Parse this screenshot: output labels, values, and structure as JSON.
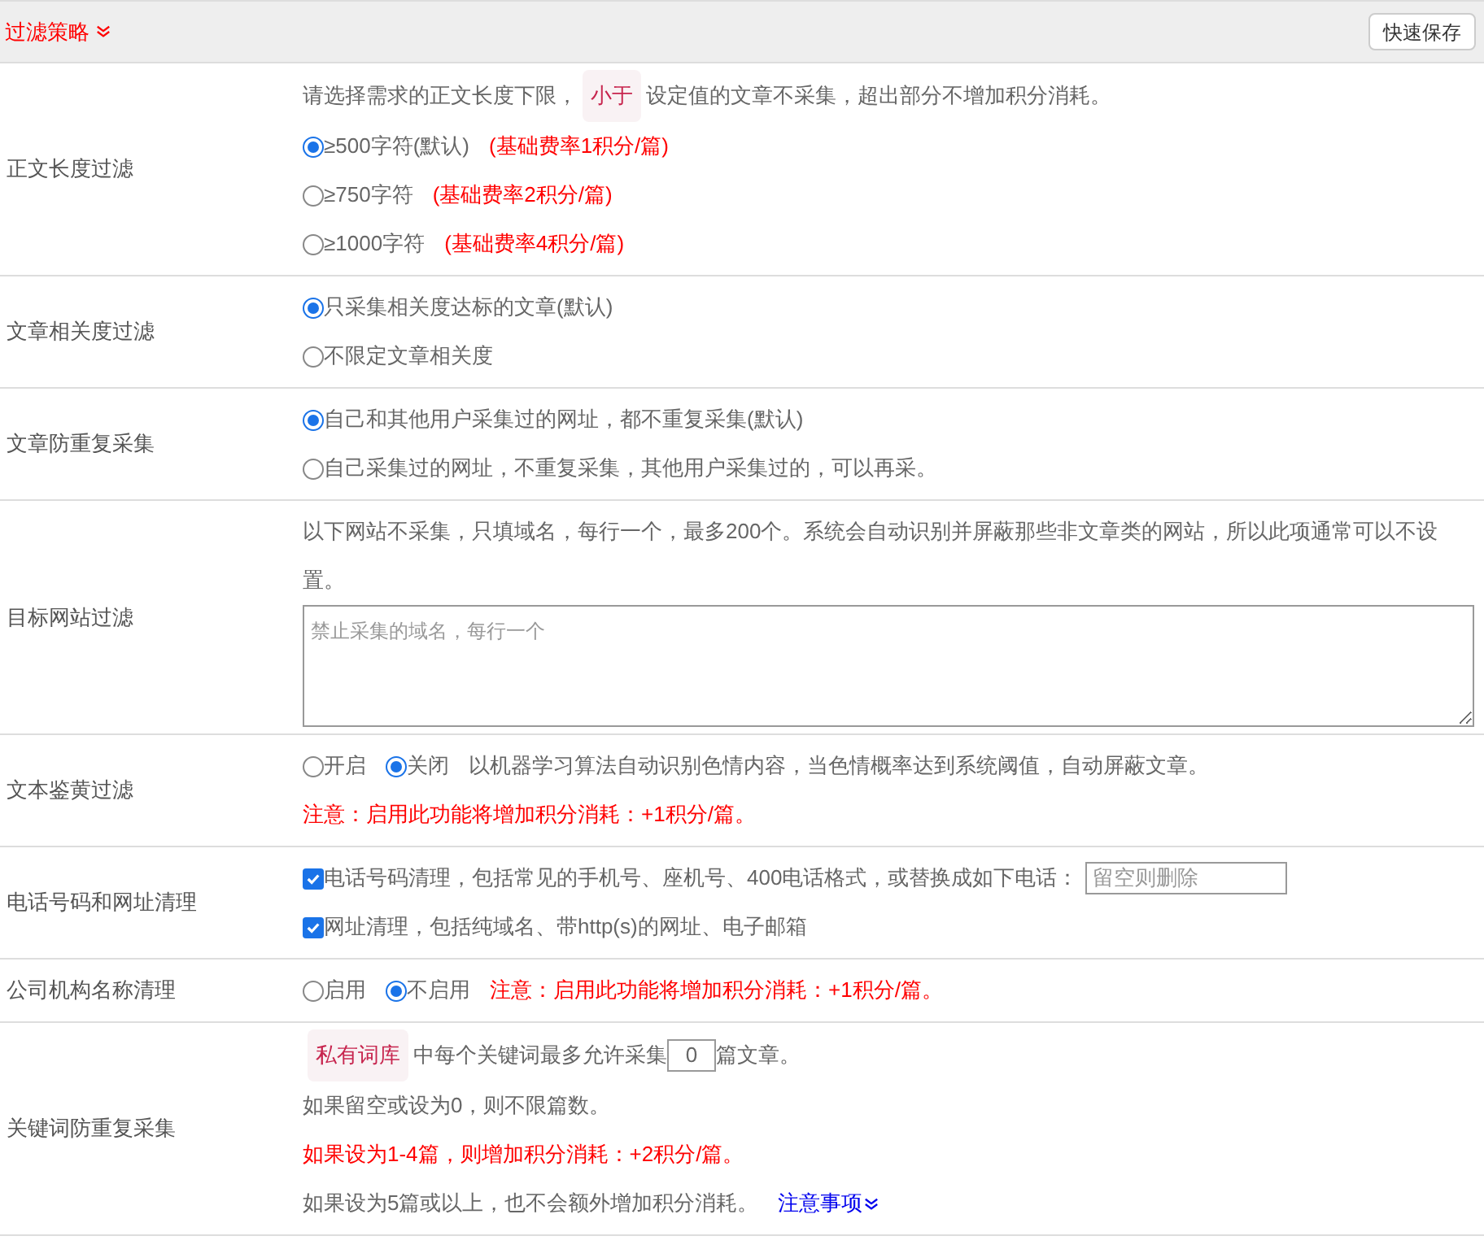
{
  "header": {
    "title": "过滤策略",
    "save_button": "快速保存"
  },
  "sections": [
    {
      "label": "正文长度过滤",
      "lines": [
        [
          {
            "kind": "text",
            "text": "请选择需求的正文长度下限，"
          },
          {
            "kind": "tag",
            "text": "小于"
          },
          {
            "kind": "text",
            "text": "设定值的文章不采集，超出部分不增加积分消耗。"
          }
        ],
        [
          {
            "kind": "radio",
            "label": "≥500字符(默认)",
            "selected": true
          },
          {
            "kind": "note",
            "text": "(基础费率1积分/篇)"
          }
        ],
        [
          {
            "kind": "radio",
            "label": "≥750字符",
            "selected": false
          },
          {
            "kind": "note",
            "text": "(基础费率2积分/篇)"
          }
        ],
        [
          {
            "kind": "radio",
            "label": "≥1000字符",
            "selected": false
          },
          {
            "kind": "note",
            "text": "(基础费率4积分/篇)"
          }
        ]
      ]
    },
    {
      "label": "文章相关度过滤",
      "lines": [
        [
          {
            "kind": "radio",
            "label": "只采集相关度达标的文章(默认)",
            "selected": true
          }
        ],
        [
          {
            "kind": "radio",
            "label": "不限定文章相关度",
            "selected": false
          }
        ]
      ]
    },
    {
      "label": "文章防重复采集",
      "lines": [
        [
          {
            "kind": "radio",
            "label": "自己和其他用户采集过的网址，都不重复采集(默认)",
            "selected": true
          }
        ],
        [
          {
            "kind": "radio",
            "label": "自己采集过的网址，不重复采集，其他用户采集过的，可以再采。",
            "selected": false
          }
        ]
      ]
    },
    {
      "label": "目标网站过滤",
      "lines": [
        [
          {
            "kind": "text",
            "text": "以下网站不采集，只填域名，每行一个，最多200个。系统会自动识别并屏蔽那些非文章类的网站，所以此项通常可以不设置。"
          }
        ],
        [
          {
            "kind": "textarea",
            "placeholder": "禁止采集的域名，每行一个"
          }
        ]
      ]
    },
    {
      "label": "文本鉴黄过滤",
      "lines": [
        [
          {
            "kind": "radio",
            "label": "开启",
            "selected": false
          },
          {
            "kind": "radio",
            "label": "关闭",
            "selected": true
          },
          {
            "kind": "text",
            "text": "以机器学习算法自动识别色情内容，当色情概率达到系统阈值，自动屏蔽文章。"
          }
        ],
        [
          {
            "kind": "note",
            "text": "注意：启用此功能将增加积分消耗：+1积分/篇。"
          }
        ]
      ]
    },
    {
      "label": "电话号码和网址清理",
      "lines": [
        [
          {
            "kind": "checkbox",
            "label": "电话号码清理，包括常见的手机号、座机号、400电话格式，或替换成如下电话：",
            "checked": true
          },
          {
            "kind": "input",
            "placeholder": "留空则删除"
          }
        ],
        [
          {
            "kind": "checkbox",
            "label": "网址清理，包括纯域名、带http(s)的网址、电子邮箱",
            "checked": true
          }
        ]
      ]
    },
    {
      "label": "公司机构名称清理",
      "lines": [
        [
          {
            "kind": "radio",
            "label": "启用",
            "selected": false
          },
          {
            "kind": "radio",
            "label": "不启用",
            "selected": true
          },
          {
            "kind": "note",
            "text": "注意：启用此功能将增加积分消耗：+1积分/篇。"
          }
        ]
      ]
    },
    {
      "label": "关键词防重复采集",
      "lines": [
        [
          {
            "kind": "tag",
            "text": "私有词库"
          },
          {
            "kind": "text",
            "text": "中每个关键词最多允许采集"
          },
          {
            "kind": "number",
            "value": "0"
          },
          {
            "kind": "text",
            "text": "篇文章。"
          }
        ],
        [
          {
            "kind": "text",
            "text": "如果留空或设为0，则不限篇数。"
          }
        ],
        [
          {
            "kind": "note",
            "text": "如果设为1-4篇，则增加积分消耗：+2积分/篇。"
          }
        ],
        [
          {
            "kind": "text",
            "text": "如果设为5篇或以上，也不会额外增加积分消耗。"
          },
          {
            "kind": "link",
            "text": "注意事项"
          }
        ]
      ]
    }
  ]
}
